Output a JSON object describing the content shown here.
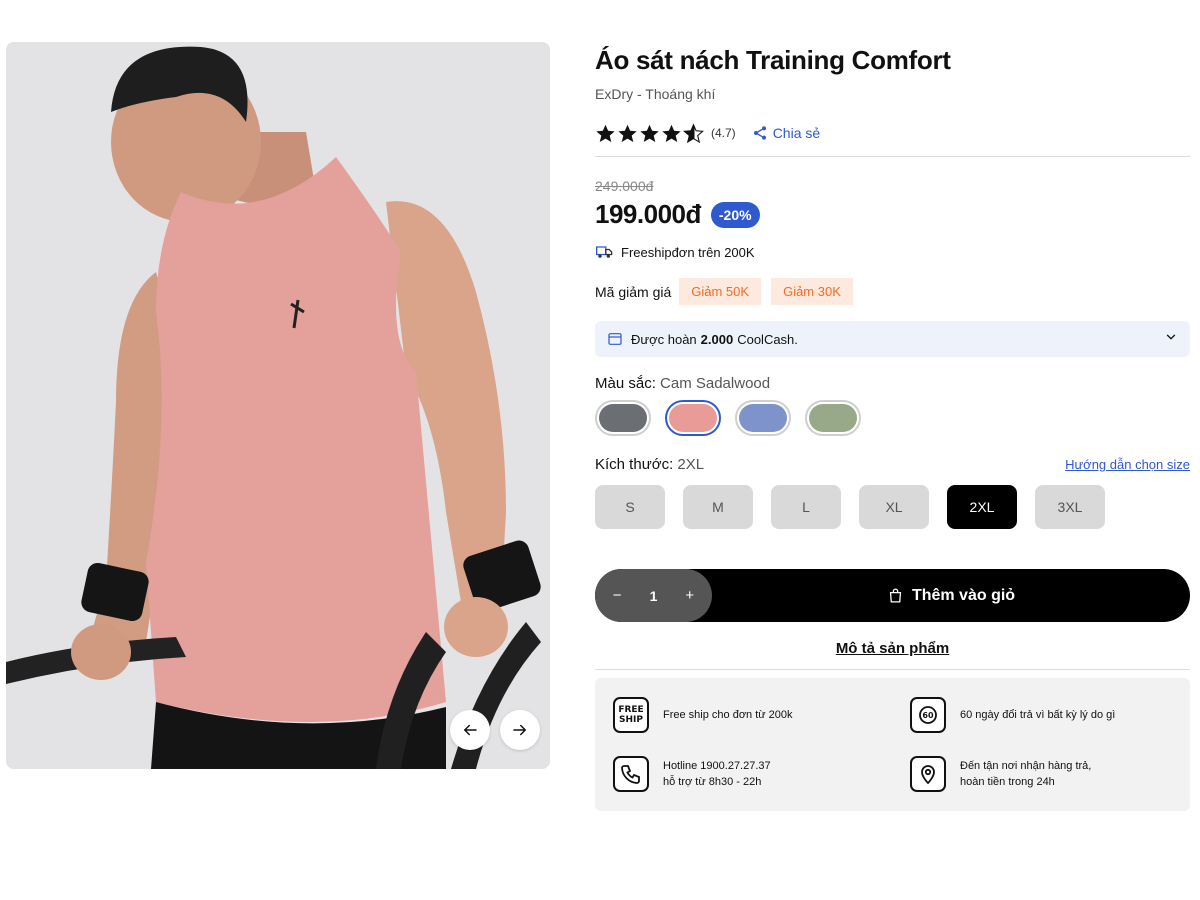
{
  "gallery": {
    "prev_icon": "arrow-left-icon",
    "next_icon": "arrow-right-icon"
  },
  "product": {
    "title": "Áo sát nách Training Comfort",
    "subtitle": "ExDry - Thoáng khí",
    "rating": 4.7,
    "rating_text": "(4.7)",
    "share_label": "Chia sẻ",
    "old_price": "249.000đ",
    "price": "199.000đ",
    "discount": "-20%",
    "freeship_text": "Freeshipđơn trên 200K"
  },
  "vouchers": {
    "label": "Mã giảm giá",
    "items": [
      "Giảm 50K",
      "Giảm 30K"
    ]
  },
  "coolcash": {
    "prefix": "Được hoàn",
    "amount": "2.000",
    "suffix": "CoolCash."
  },
  "color": {
    "label": "Màu sắc:",
    "selected": "Cam Sadalwood",
    "swatches": [
      {
        "name": "grey",
        "color": "#6b6e73"
      },
      {
        "name": "cam-sadalwood",
        "color": "#e99b97"
      },
      {
        "name": "blue",
        "color": "#7d93c9"
      },
      {
        "name": "green",
        "color": "#98a98a"
      }
    ],
    "selected_index": 1
  },
  "size": {
    "label": "Kích thước:",
    "selected": "2XL",
    "guide": "Hướng dẫn chọn size",
    "options": [
      "S",
      "M",
      "L",
      "XL",
      "2XL",
      "3XL"
    ],
    "selected_index": 4
  },
  "cart": {
    "minus": "−",
    "qty": "1",
    "plus": "+",
    "add_label": "Thêm vào giỏ"
  },
  "description_link": "Mô tả sản phẩm",
  "policies": [
    {
      "icon": "free-ship-icon",
      "icon_text": "FREE SHIP",
      "line1": "Free ship cho đơn từ 200k",
      "line2": ""
    },
    {
      "icon": "return-60-icon",
      "icon_text": "60",
      "line1": "60 ngày đổi trả vì bất kỳ lý do gì",
      "line2": ""
    },
    {
      "icon": "phone-icon",
      "icon_text": "",
      "line1": "Hotline 1900.27.27.37",
      "line2": "hỗ trợ từ 8h30 - 22h"
    },
    {
      "icon": "location-icon",
      "icon_text": "",
      "line1": "Đến tận nơi nhận hàng trả,",
      "line2": "hoàn tiền trong 24h"
    }
  ],
  "colors": {
    "accent": "#2f5acf",
    "voucher_bg": "#fde9dd",
    "voucher_text": "#f26c25",
    "coolcash_bg": "#eef3fb"
  }
}
